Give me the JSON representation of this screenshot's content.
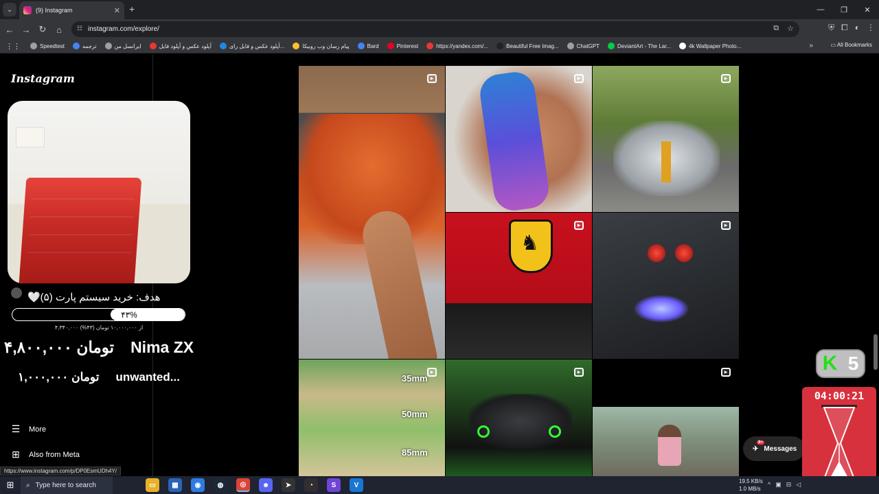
{
  "browser": {
    "tab_title": "(9) Instagram",
    "new_tab": "+",
    "url": "instagram.com/explore/",
    "window_controls": [
      "—",
      "❐",
      "✕"
    ]
  },
  "bookmarks": {
    "items": [
      {
        "label": "Speedtest",
        "color": "#9aa0a6"
      },
      {
        "label": "ترجمه",
        "color": "#4285f4"
      },
      {
        "label": "ایرانسل من",
        "color": "#9aa0a6"
      },
      {
        "label": "آپلود عکس و آپلود فایل",
        "color": "#e53935"
      },
      {
        "label": "آپلود عکس و فایل رای...",
        "color": "#1e88e5"
      },
      {
        "label": "پیام رسان وب روبیکا",
        "color": "#fbc02d"
      },
      {
        "label": "Bard",
        "color": "#4285f4"
      },
      {
        "label": "Pinterest",
        "color": "#e60023"
      },
      {
        "label": "https://yandex.com/...",
        "color": "#e53935"
      },
      {
        "label": "Beautiful Free Imag...",
        "color": "#222222"
      },
      {
        "label": "ChatGPT",
        "color": "#9aa0a6"
      },
      {
        "label": "DeviantArt - The Lar...",
        "color": "#05cc47"
      },
      {
        "label": "4k Wallpaper Photo...",
        "color": "#ffffff"
      }
    ],
    "all_bookmarks": "All Bookmarks"
  },
  "sidebar": {
    "logo": "Instagram",
    "goal_title": "هدف: خرید سیستم پارت (۵)🤍",
    "goal_percent_label": "۴۳%",
    "goal_progress": 0.43,
    "goal_sub": "۴,۳۴۰,۰۰۰ از ۱۰,۰۰۰,۰۰۰ تومان (۴۳%)",
    "donors": [
      {
        "name": "Nima ZX",
        "amount": "۴,۸۰۰,۰۰۰ تومان"
      },
      {
        "name": "unwanted...",
        "amount": "۱,۰۰۰,۰۰۰ تومان"
      }
    ],
    "menu": [
      {
        "label": "More",
        "icon": "hamburger-icon"
      },
      {
        "label": "Also from Meta",
        "icon": "meta-apps-icon"
      }
    ]
  },
  "grid": {
    "lens_labels": [
      "35mm",
      "50mm",
      "85mm"
    ]
  },
  "overlays": {
    "k_letter": "K",
    "k_number": "5",
    "timer": "04:00:21",
    "messages_label": "Messages",
    "messages_badge": "9+"
  },
  "status_bar": {
    "link": "https://www.instagram.com/p/DP0EsmUDh4Y/"
  },
  "taskbar": {
    "search_placeholder": "Type here to search",
    "net_up": "19.5 KB/s",
    "net_down": "1.0 MB/s"
  }
}
